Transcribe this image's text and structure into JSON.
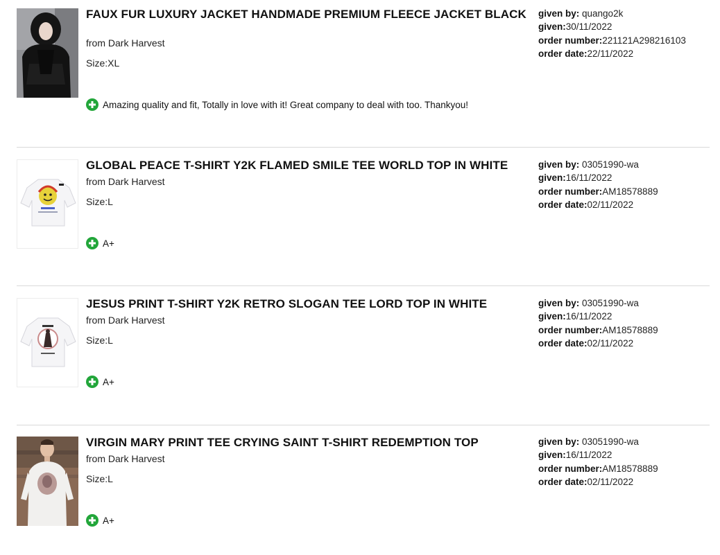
{
  "entries": [
    {
      "title": "FAUX FUR LUXURY JACKET HANDMADE PREMIUM FLEECE JACKET BLACK",
      "seller": "from Dark Harvest",
      "size": "Size:XL",
      "comment": "Amazing quality and fit, Totally in love with it! Great company to deal with too. Thankyou!",
      "given_by_label": "given by:",
      "given_by": " quango2k",
      "given_label": "given:",
      "given": "30/11/2022",
      "order_number_label": "order number:",
      "order_number": "221121A298216103",
      "order_date_label": "order date:",
      "order_date": "22/11/2022"
    },
    {
      "title": "GLOBAL PEACE T-SHIRT Y2K FLAMED SMILE TEE WORLD TOP IN WHITE",
      "seller": "from Dark Harvest",
      "size": "Size:L",
      "comment": "A+",
      "given_by_label": "given by:",
      "given_by": " 03051990-wa",
      "given_label": "given:",
      "given": "16/11/2022",
      "order_number_label": "order number:",
      "order_number": "AM18578889",
      "order_date_label": "order date:",
      "order_date": "02/11/2022"
    },
    {
      "title": "JESUS PRINT T-SHIRT Y2K RETRO SLOGAN TEE LORD TOP IN WHITE",
      "seller": "from Dark Harvest",
      "size": "Size:L",
      "comment": "A+",
      "given_by_label": "given by:",
      "given_by": " 03051990-wa",
      "given_label": "given:",
      "given": "16/11/2022",
      "order_number_label": "order number:",
      "order_number": "AM18578889",
      "order_date_label": "order date:",
      "order_date": "02/11/2022"
    },
    {
      "title": "VIRGIN MARY PRINT TEE CRYING SAINT T-SHIRT REDEMPTION TOP",
      "seller": "from Dark Harvest",
      "size": "Size:L",
      "comment": "A+",
      "given_by_label": "given by:",
      "given_by": " 03051990-wa",
      "given_label": "given:",
      "given": "16/11/2022",
      "order_number_label": "order number:",
      "order_number": "AM18578889",
      "order_date_label": "order date:",
      "order_date": "02/11/2022"
    }
  ],
  "icons": {
    "positive": "plus-circle-icon"
  },
  "colors": {
    "positive": "#22a63a",
    "divider": "#d9d9d9"
  }
}
